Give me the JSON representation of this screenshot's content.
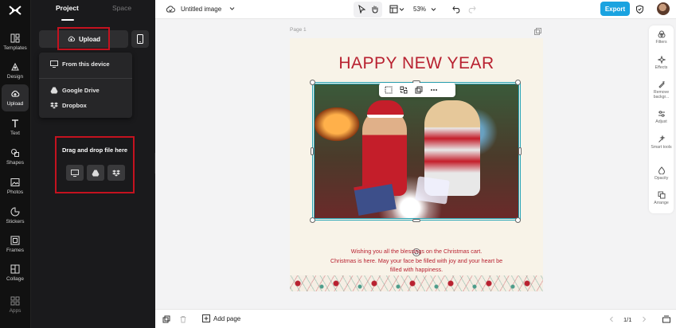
{
  "left_rail": {
    "items": [
      {
        "label": "Templates",
        "icon": "templates-icon"
      },
      {
        "label": "Design",
        "icon": "design-icon"
      },
      {
        "label": "Upload",
        "icon": "upload-cloud-icon",
        "active": true
      },
      {
        "label": "Text",
        "icon": "text-icon"
      },
      {
        "label": "Shapes",
        "icon": "shapes-icon"
      },
      {
        "label": "Photos",
        "icon": "photos-icon"
      },
      {
        "label": "Stickers",
        "icon": "stickers-icon"
      },
      {
        "label": "Frames",
        "icon": "frames-icon"
      },
      {
        "label": "Collage",
        "icon": "collage-icon"
      },
      {
        "label": "Apps",
        "icon": "apps-icon"
      }
    ]
  },
  "panel": {
    "tabs": [
      {
        "label": "Project"
      },
      {
        "label": "Space"
      }
    ],
    "upload_label": "Upload",
    "dropdown": [
      {
        "label": "From this device",
        "icon": "monitor-icon"
      },
      {
        "label": "Google Drive",
        "icon": "google-drive-icon"
      },
      {
        "label": "Dropbox",
        "icon": "dropbox-icon"
      }
    ],
    "drop_zone_title": "Drag and drop file here"
  },
  "topbar": {
    "doc_title": "Untitled image",
    "zoom": "53%",
    "export_label": "Export"
  },
  "canvas": {
    "page_label": "Page 1",
    "headline": "HAPPY NEW YEAR",
    "message_lines": [
      "Wishing you all the blessings on the Christmas cart.",
      "Christmas is here. May your face be filled with joy and your heart be",
      "filled with happiness."
    ]
  },
  "right_tools": [
    {
      "label": "Filters",
      "icon": "filters-icon"
    },
    {
      "label": "Effects",
      "icon": "effects-icon"
    },
    {
      "label": "Remove backgr...",
      "icon": "remove-background-icon"
    },
    {
      "label": "Adjust",
      "icon": "adjust-icon"
    },
    {
      "label": "Smart tools",
      "icon": "smart-tools-icon"
    },
    {
      "label": "Opacity",
      "icon": "opacity-icon"
    },
    {
      "label": "Arrange",
      "icon": "arrange-icon"
    }
  ],
  "bottombar": {
    "add_page_label": "Add page",
    "pager": "1/1"
  },
  "colors": {
    "accent": "#1aa3e0",
    "highlight_red": "#c4121f",
    "headline_red": "#b82130",
    "selection": "#2aa6b8"
  }
}
